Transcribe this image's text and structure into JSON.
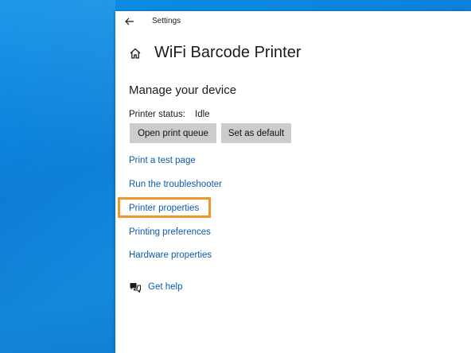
{
  "window": {
    "title": "Settings",
    "back_icon": "back-arrow-icon"
  },
  "page": {
    "title": "WiFi Barcode Printer",
    "home_icon": "home-icon"
  },
  "section": {
    "title": "Manage your device",
    "status_label": "Printer status:",
    "status_value": "Idle"
  },
  "buttons": {
    "open_queue": "Open print queue",
    "set_default": "Set as default"
  },
  "links": {
    "test_page": "Print a test page",
    "troubleshooter": "Run the troubleshooter",
    "printer_properties": "Printer properties",
    "printing_preferences": "Printing preferences",
    "hardware_properties": "Hardware properties"
  },
  "help": {
    "label": "Get help",
    "icon": "help-chat-icon"
  },
  "colors": {
    "link": "#0b5cad",
    "highlight": "#f0962a",
    "button_bg": "#cccccc",
    "desktop": "#0d7fd8"
  }
}
